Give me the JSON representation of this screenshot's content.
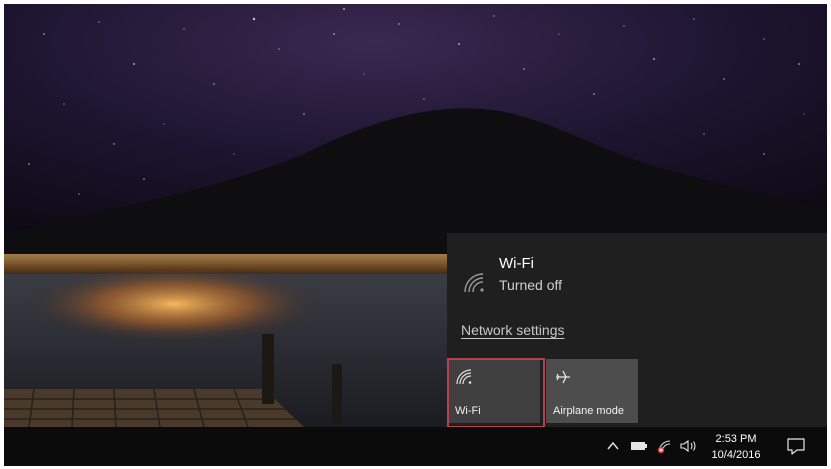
{
  "network_flyout": {
    "network_name": "Wi-Fi",
    "network_status": "Turned off",
    "settings_link": "Network settings",
    "tiles": [
      {
        "label": "Wi-Fi",
        "icon": "wifi-icon",
        "active": false,
        "highlighted": true
      },
      {
        "label": "Airplane mode",
        "icon": "airplane-icon",
        "active": false,
        "highlighted": false
      }
    ],
    "highlight_color": "#b5404f"
  },
  "taskbar": {
    "tray_icons": [
      "chevron-up-icon",
      "battery-icon",
      "network-disabled-icon",
      "volume-icon"
    ],
    "time": "2:53 PM",
    "date": "10/4/2016",
    "action_center_icon": "notification-icon"
  }
}
